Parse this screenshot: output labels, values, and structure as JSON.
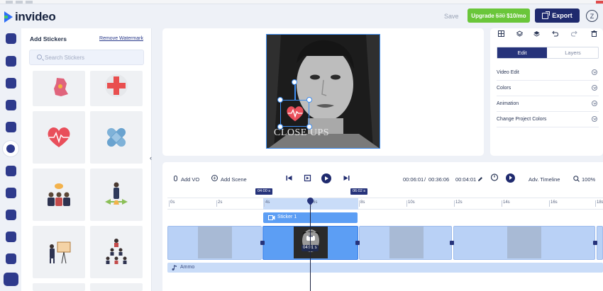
{
  "app": {
    "name": "invideo"
  },
  "header": {
    "save_label": "Save",
    "upgrade_label": "Upgrade",
    "upgrade_old_price": "$30",
    "upgrade_price": "$10/mo",
    "export_label": "Export",
    "avatar_letter": "Z"
  },
  "sidebar_icons": [
    "video-icon",
    "text-icon",
    "music-icon",
    "image-icon",
    "upload-icon",
    "sticker-icon",
    "play-icon",
    "shape-icon",
    "brand-icon",
    "layout-icon",
    "like-icon",
    "chat-icon"
  ],
  "stickers": {
    "title": "Add Stickers",
    "remove_watermark": "Remove Watermark",
    "search_placeholder": "Search Stickers",
    "items": [
      "germany-map",
      "medical-cross",
      "heart-beat",
      "bandage",
      "team-chat",
      "businessman-arrows",
      "presentation",
      "hierarchy"
    ]
  },
  "preview": {
    "caption": "CLOSE UPS"
  },
  "right_panel": {
    "tab_edit": "Edit",
    "tab_layers": "Layers",
    "sections": [
      "Video Edit",
      "Colors",
      "Animation",
      "Change Project Colors"
    ]
  },
  "timeline": {
    "add_vo": "Add VO",
    "add_scene": "Add Scene",
    "current_time": "00:06:01",
    "total_time": "00:36:06",
    "scene_duration": "00:04:01",
    "adv_timeline": "Adv. Timeline",
    "zoom": "100%",
    "marker_start": "04:00 s",
    "marker_end": "06:02 s",
    "ticks": [
      "0s",
      "2s",
      "4s",
      "6s",
      "8s",
      "10s",
      "12s",
      "14s",
      "16s",
      "18s"
    ],
    "sticker_clip": "Sticker 1",
    "clip_time": "04:01 s",
    "audio_label": "Ammo"
  }
}
